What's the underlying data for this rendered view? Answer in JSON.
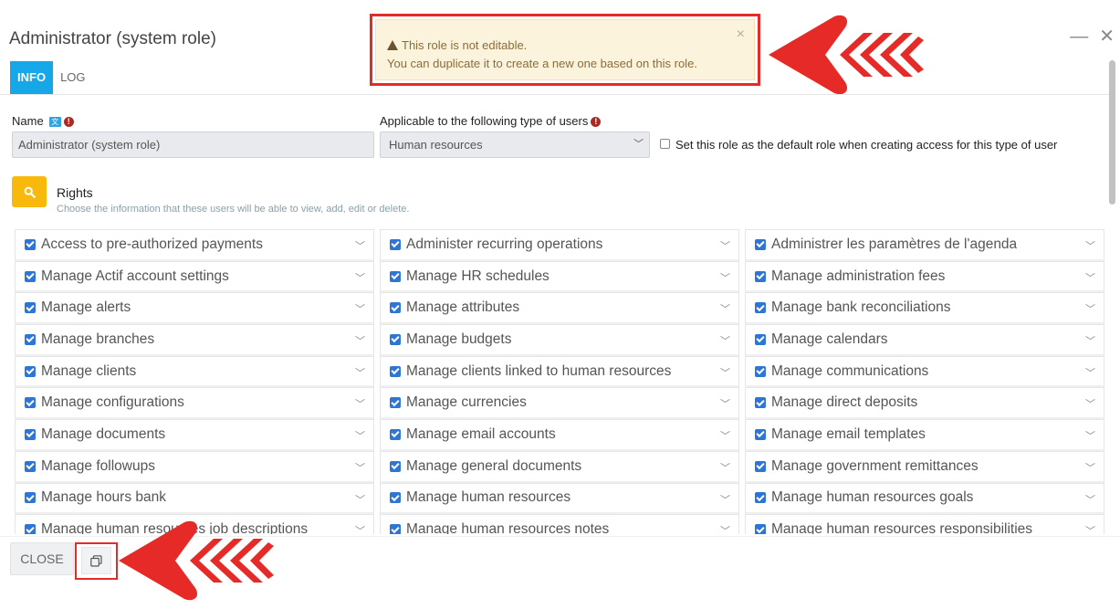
{
  "dialog": {
    "title": "Administrator (system role)",
    "minimize_glyph": "—",
    "close_glyph": "✕"
  },
  "alert": {
    "line1": "This role is not editable.",
    "line2": "You can duplicate it to create a new one based on this role.",
    "close_glyph": "×",
    "icon": "warning-triangle-icon"
  },
  "tabs": [
    {
      "label": "INFO",
      "active": true
    },
    {
      "label": "LOG",
      "active": false
    }
  ],
  "form": {
    "name_label": "Name",
    "name_value": "Administrator (system role)",
    "type_label": "Applicable to the following type of users",
    "type_value": "Human resources",
    "default_checkbox_label": "Set this role as the default role when creating access for this type of user",
    "default_checked": false
  },
  "rights": {
    "title": "Rights",
    "subtitle": "Choose the information that these users will be able to view, add, edit or delete.",
    "items": [
      "Access to pre-authorized payments",
      "Administer recurring operations",
      "Administrer les paramètres de l'agenda",
      "Manage Actif account settings",
      "Manage HR schedules",
      "Manage administration fees",
      "Manage alerts",
      "Manage attributes",
      "Manage bank reconciliations",
      "Manage branches",
      "Manage budgets",
      "Manage calendars",
      "Manage clients",
      "Manage clients linked to human resources",
      "Manage communications",
      "Manage configurations",
      "Manage currencies",
      "Manage direct deposits",
      "Manage documents",
      "Manage email accounts",
      "Manage email templates",
      "Manage followups",
      "Manage general documents",
      "Manage government remittances",
      "Manage hours bank",
      "Manage human resources",
      "Manage human resources goals",
      "Manage human resources job descriptions",
      "Manage human resources notes",
      "Manage human resources responsibilities"
    ]
  },
  "footer": {
    "close_label": "CLOSE",
    "duplicate_icon": "duplicate-icon"
  },
  "colors": {
    "accent_blue": "#16a7e9",
    "checkbox_blue": "#2e76d6",
    "search_yellow": "#f9b90c",
    "annotation_red": "#e52a28",
    "alert_bg": "#fbf3dc",
    "alert_text": "#8a6d3b"
  }
}
